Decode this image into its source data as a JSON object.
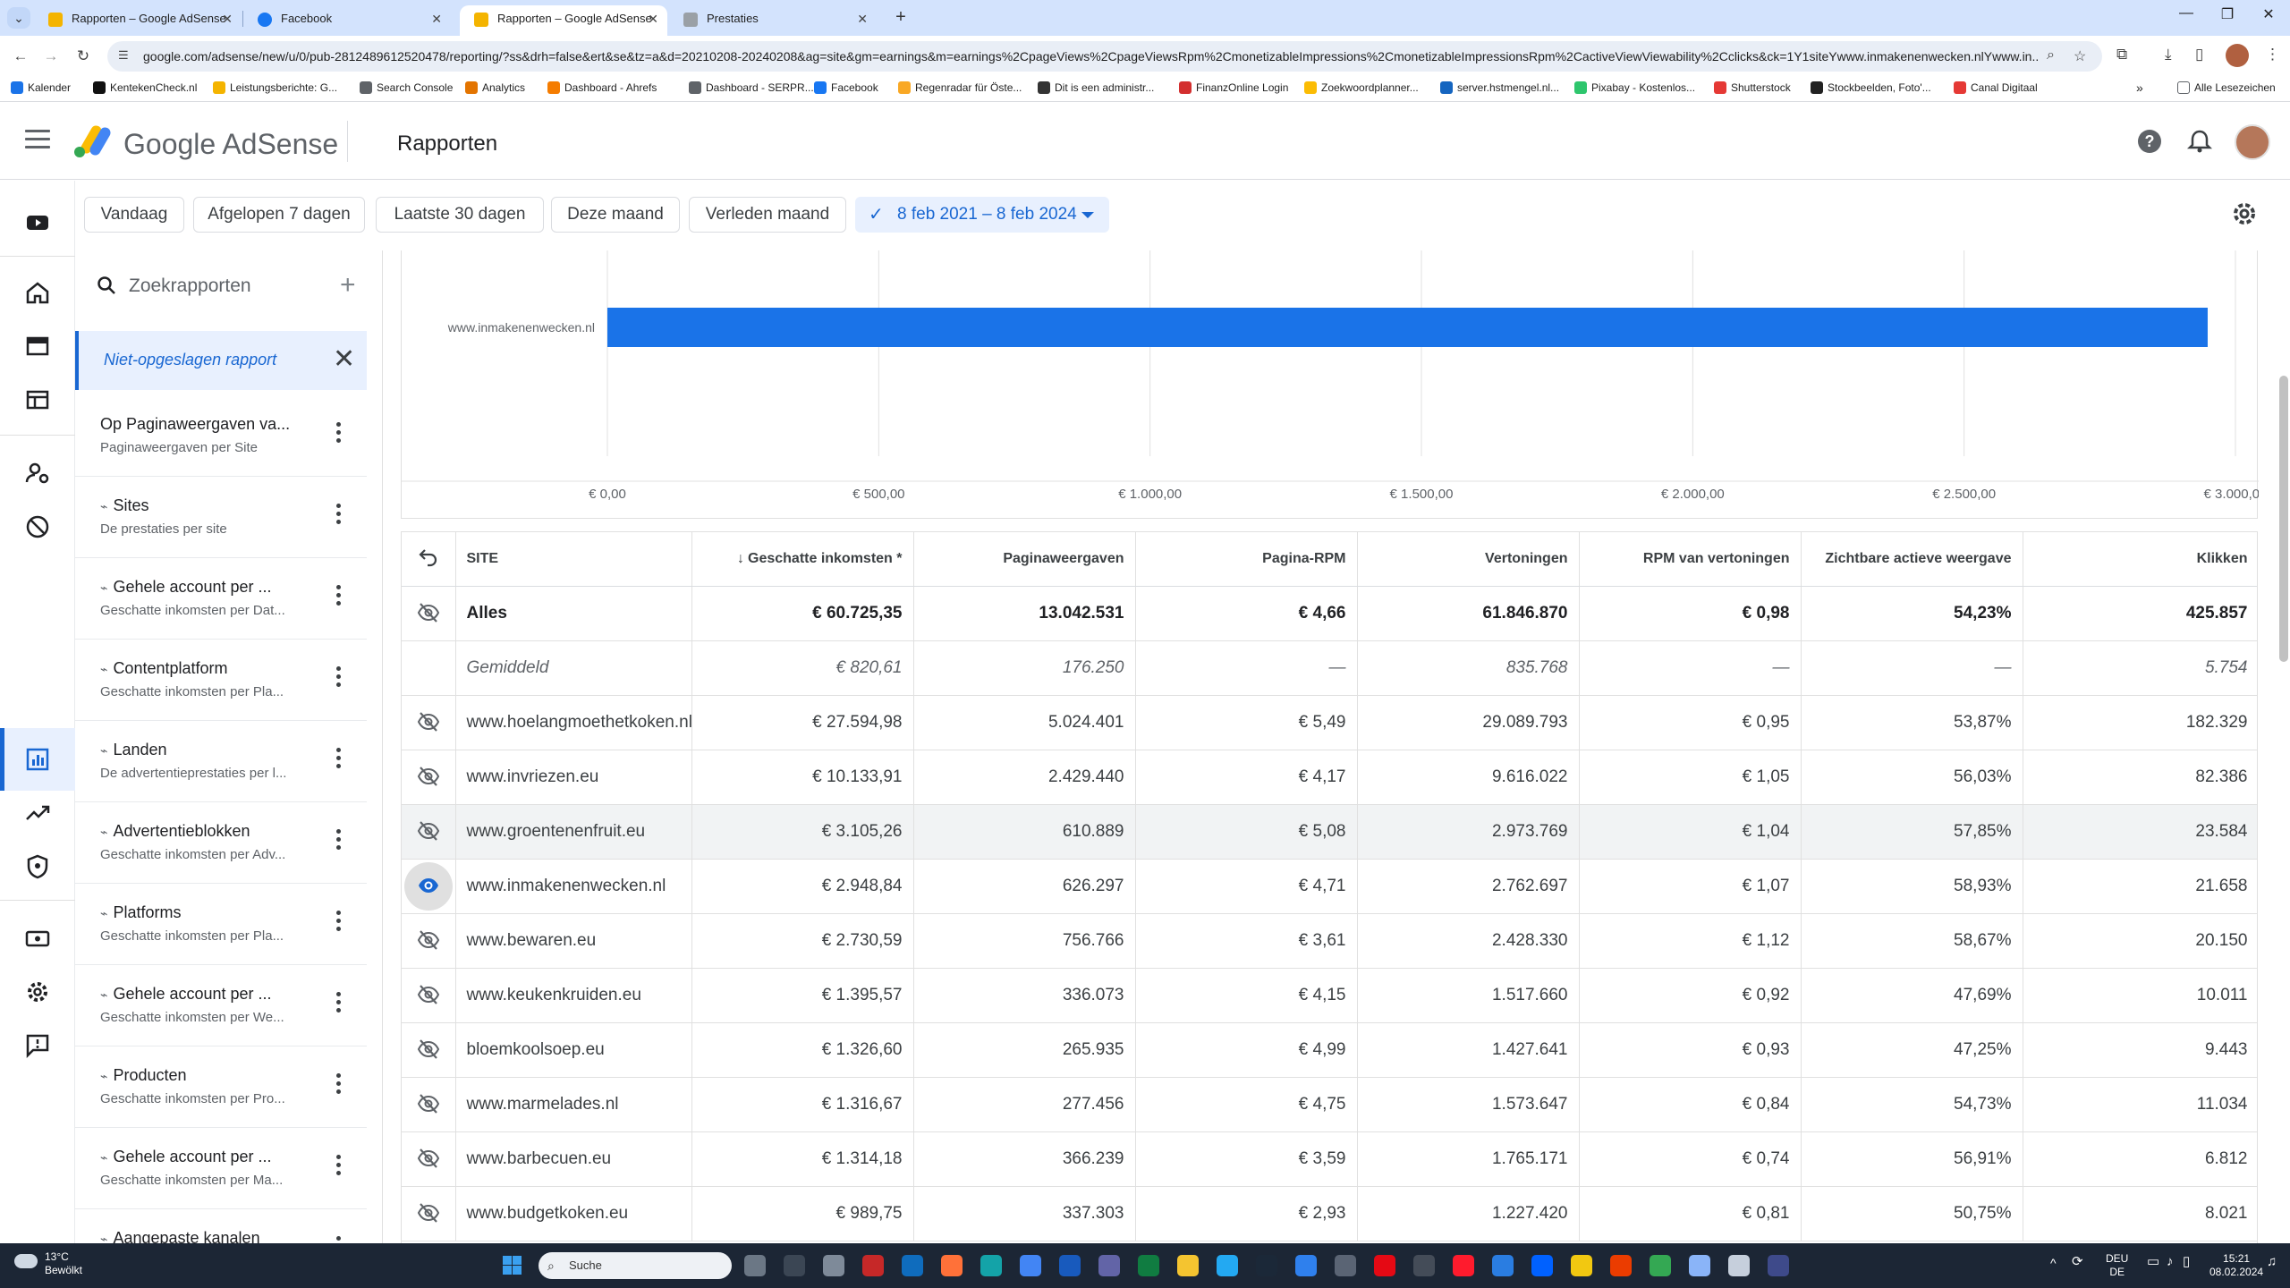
{
  "browser": {
    "tabs": [
      {
        "title": "Rapporten – Google AdSense",
        "color": "#f4b400"
      },
      {
        "title": "Facebook",
        "color": "#1877f2"
      },
      {
        "title": "Rapporten – Google AdSense",
        "color": "#f4b400"
      },
      {
        "title": "Prestaties",
        "color": "#9aa0a6"
      }
    ],
    "url": "google.com/adsense/new/u/0/pub-2812489612520478/reporting/?ss&drh=false&ert&se&tz=a&d=20210208-20240208&ag=site&gm=earnings&m=earnings%2CpageViews%2CpageViewsRpm%2CmonetizableImpressions%2CmonetizableImpressionsRpm%2CactiveViewViewability%2Cclicks&ck=1Y1siteYwww.inmakenenwecken.nlYwww.in...",
    "bookmarks": [
      {
        "label": "Kalender",
        "color": "#1a73e8"
      },
      {
        "label": "KentekenCheck.nl",
        "color": "#111111"
      },
      {
        "label": "Leistungsberichte: G...",
        "color": "#f4b400"
      },
      {
        "label": "Search Console",
        "color": "#5f6368"
      },
      {
        "label": "Analytics",
        "color": "#e37400"
      },
      {
        "label": "Dashboard - Ahrefs",
        "color": "#f57c00"
      },
      {
        "label": "Dashboard - SERPR...",
        "color": "#5f6368"
      },
      {
        "label": "Facebook",
        "color": "#1877f2"
      },
      {
        "label": "Regenradar für Öste...",
        "color": "#f9a825"
      },
      {
        "label": "Dit is een administr...",
        "color": "#333333"
      },
      {
        "label": "FinanzOnline Login",
        "color": "#d32f2f"
      },
      {
        "label": "Zoekwoordplanner...",
        "color": "#fbbc04"
      },
      {
        "label": "server.hstmengel.nl...",
        "color": "#1565c0"
      },
      {
        "label": "Pixabay - Kostenlos...",
        "color": "#2ec66d"
      },
      {
        "label": "Shutterstock",
        "color": "#e53935"
      },
      {
        "label": "Stockbeelden, Foto'...",
        "color": "#222222"
      },
      {
        "label": "Canal Digitaal",
        "color": "#e53935"
      }
    ],
    "other_bookmarks": "Alle Lesezeichen"
  },
  "header": {
    "brand": "Google AdSense",
    "page_title": "Rapporten"
  },
  "filters": {
    "chips": [
      "Vandaag",
      "Afgelopen 7 dagen",
      "Laatste 30 dagen",
      "Deze maand",
      "Verleden maand"
    ],
    "date_range": "8 feb 2021 – 8 feb 2024"
  },
  "reports_panel": {
    "search_placeholder": "Zoekrapporten",
    "unsaved_label": "Niet-opgeslagen rapport",
    "items": [
      {
        "title": "Op Paginaweergaven va...",
        "subtitle": "Paginaweergaven per Site",
        "spark": false
      },
      {
        "title": "Sites",
        "subtitle": "De prestaties per site",
        "spark": true
      },
      {
        "title": "Gehele account per ...",
        "subtitle": "Geschatte inkomsten per Dat...",
        "spark": true
      },
      {
        "title": "Contentplatform",
        "subtitle": "Geschatte inkomsten per Pla...",
        "spark": true
      },
      {
        "title": "Landen",
        "subtitle": "De advertentieprestaties per l...",
        "spark": true
      },
      {
        "title": "Advertentieblokken",
        "subtitle": "Geschatte inkomsten per Adv...",
        "spark": true
      },
      {
        "title": "Platforms",
        "subtitle": "Geschatte inkomsten per Pla...",
        "spark": true
      },
      {
        "title": "Gehele account per ...",
        "subtitle": "Geschatte inkomsten per We...",
        "spark": true
      },
      {
        "title": "Producten",
        "subtitle": "Geschatte inkomsten per Pro...",
        "spark": true
      },
      {
        "title": "Gehele account per ...",
        "subtitle": "Geschatte inkomsten per Ma...",
        "spark": true
      },
      {
        "title": "Aangepaste kanalen",
        "subtitle": "",
        "spark": true
      }
    ]
  },
  "chart_data": {
    "type": "bar",
    "orientation": "horizontal",
    "categories": [
      "www.inmakenenwecken.nl"
    ],
    "values": [
      2948.84
    ],
    "xlim": [
      0,
      3000
    ],
    "x_ticks": [
      "€ 0,00",
      "€ 500,00",
      "€ 1.000,00",
      "€ 1.500,00",
      "€ 2.000,00",
      "€ 2.500,00",
      "€ 3.000,00"
    ],
    "x_tick_values": [
      0,
      500,
      1000,
      1500,
      2000,
      2500,
      3000
    ],
    "grid": true,
    "bar_color": "#1a73e8"
  },
  "table": {
    "columns": [
      "SITE",
      "Geschatte inkomsten *",
      "Paginaweergaven",
      "Pagina-RPM",
      "Vertoningen",
      "RPM van vertoningen",
      "Zichtbare actieve weergave",
      "Klikken"
    ],
    "total": {
      "site": "Alles",
      "values": [
        "€ 60.725,35",
        "13.042.531",
        "€ 4,66",
        "61.846.870",
        "€ 0,98",
        "54,23%",
        "425.857"
      ]
    },
    "average": {
      "site": "Gemiddeld",
      "values": [
        "€ 820,61",
        "176.250",
        "—",
        "835.768",
        "—",
        "—",
        "5.754"
      ]
    },
    "rows": [
      {
        "site": "www.hoelangmoethetkoken.nl",
        "visible": false,
        "values": [
          "€ 27.594,98",
          "5.024.401",
          "€ 5,49",
          "29.089.793",
          "€ 0,95",
          "53,87%",
          "182.329"
        ]
      },
      {
        "site": "www.invriezen.eu",
        "visible": false,
        "values": [
          "€ 10.133,91",
          "2.429.440",
          "€ 4,17",
          "9.616.022",
          "€ 1,05",
          "56,03%",
          "82.386"
        ]
      },
      {
        "site": "www.groentenenfruit.eu",
        "visible": false,
        "highlight": true,
        "values": [
          "€ 3.105,26",
          "610.889",
          "€ 5,08",
          "2.973.769",
          "€ 1,04",
          "57,85%",
          "23.584"
        ]
      },
      {
        "site": "www.inmakenenwecken.nl",
        "visible": true,
        "values": [
          "€ 2.948,84",
          "626.297",
          "€ 4,71",
          "2.762.697",
          "€ 1,07",
          "58,93%",
          "21.658"
        ]
      },
      {
        "site": "www.bewaren.eu",
        "visible": false,
        "values": [
          "€ 2.730,59",
          "756.766",
          "€ 3,61",
          "2.428.330",
          "€ 1,12",
          "58,67%",
          "20.150"
        ]
      },
      {
        "site": "www.keukenkruiden.eu",
        "visible": false,
        "values": [
          "€ 1.395,57",
          "336.073",
          "€ 4,15",
          "1.517.660",
          "€ 0,92",
          "47,69%",
          "10.011"
        ]
      },
      {
        "site": "bloemkoolsoep.eu",
        "visible": false,
        "values": [
          "€ 1.326,60",
          "265.935",
          "€ 4,99",
          "1.427.641",
          "€ 0,93",
          "47,25%",
          "9.443"
        ]
      },
      {
        "site": "www.marmelades.nl",
        "visible": false,
        "values": [
          "€ 1.316,67",
          "277.456",
          "€ 4,75",
          "1.573.647",
          "€ 0,84",
          "54,73%",
          "11.034"
        ]
      },
      {
        "site": "www.barbecuen.eu",
        "visible": false,
        "values": [
          "€ 1.314,18",
          "366.239",
          "€ 3,59",
          "1.765.171",
          "€ 0,74",
          "56,91%",
          "6.812"
        ]
      },
      {
        "site": "www.budgetkoken.eu",
        "visible": false,
        "values": [
          "€ 989,75",
          "337.303",
          "€ 2,93",
          "1.227.420",
          "€ 0,81",
          "50,75%",
          "8.021"
        ]
      }
    ]
  },
  "taskbar": {
    "weather_temp": "13°C",
    "weather_desc": "Bewölkt",
    "search_label": "Suche",
    "lang_top": "DEU",
    "lang_bottom": "DE",
    "time": "15:21",
    "date": "08.02.2024"
  }
}
